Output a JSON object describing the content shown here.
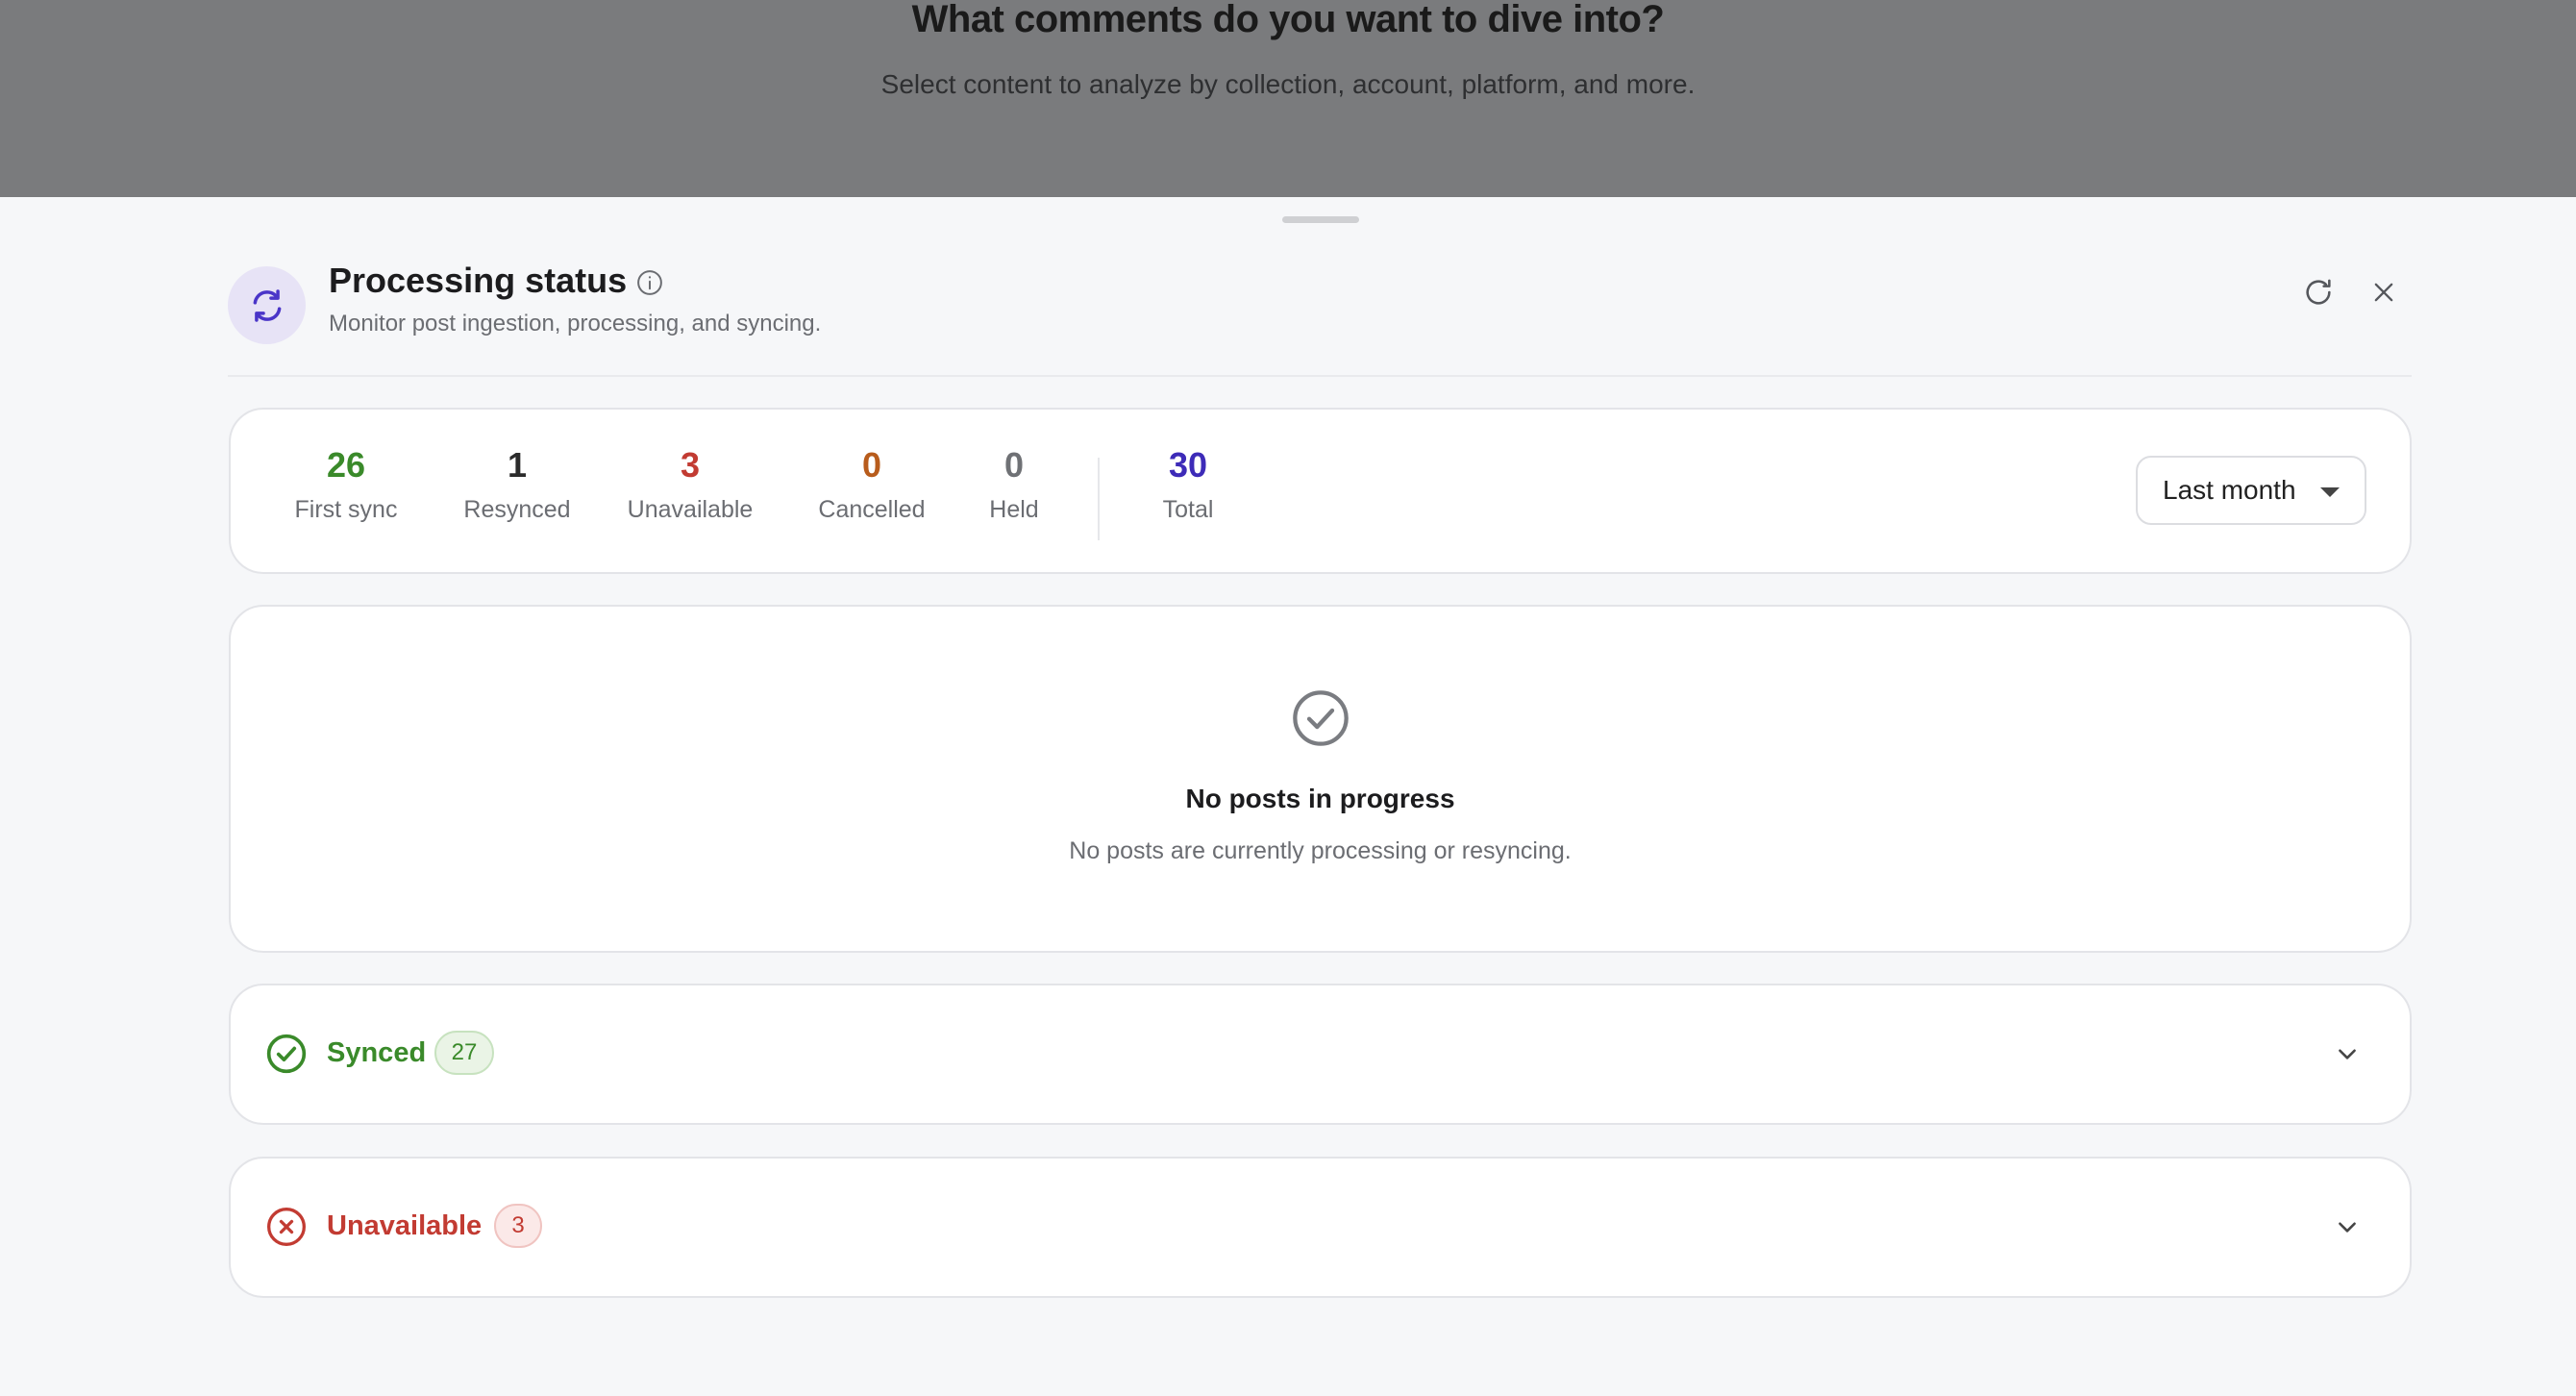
{
  "backdrop": {
    "title": "What comments do you want to dive into?",
    "subtitle": "Select content to analyze by collection, account, platform, and more."
  },
  "panel": {
    "title": "Processing status",
    "subtitle": "Monitor post ingestion, processing, and syncing.",
    "icons": {
      "header": "sync-icon",
      "info": "info-icon",
      "refresh": "refresh-icon",
      "close": "close-icon"
    }
  },
  "stats": [
    {
      "value": "26",
      "label": "First sync",
      "color": "#3a8a2a"
    },
    {
      "value": "1",
      "label": "Resynced",
      "color": "#2b2b2b"
    },
    {
      "value": "3",
      "label": "Unavailable",
      "color": "#c23b32"
    },
    {
      "value": "0",
      "label": "Cancelled",
      "color": "#b85c1c"
    },
    {
      "value": "0",
      "label": "Held",
      "color": "#6f7175"
    },
    {
      "value": "30",
      "label": "Total",
      "color": "#3d2bb8"
    }
  ],
  "range_select": {
    "value": "Last month"
  },
  "empty_state": {
    "title": "No posts in progress",
    "subtitle": "No posts are currently processing or resyncing.",
    "icon": "check-circle-icon"
  },
  "sections": [
    {
      "label": "Synced",
      "count": "27",
      "color": "#3a8a2a",
      "badge_bg": "#eaf4e6",
      "badge_border": "#c7e2bf",
      "icon": "check-circle-icon"
    },
    {
      "label": "Unavailable",
      "count": "3",
      "color": "#c23b32",
      "badge_bg": "#fbe9e8",
      "badge_border": "#f0c4c1",
      "icon": "x-circle-icon"
    }
  ],
  "colors": {
    "accent": "#4a35c8",
    "accent_soft": "#e7e3f6"
  }
}
